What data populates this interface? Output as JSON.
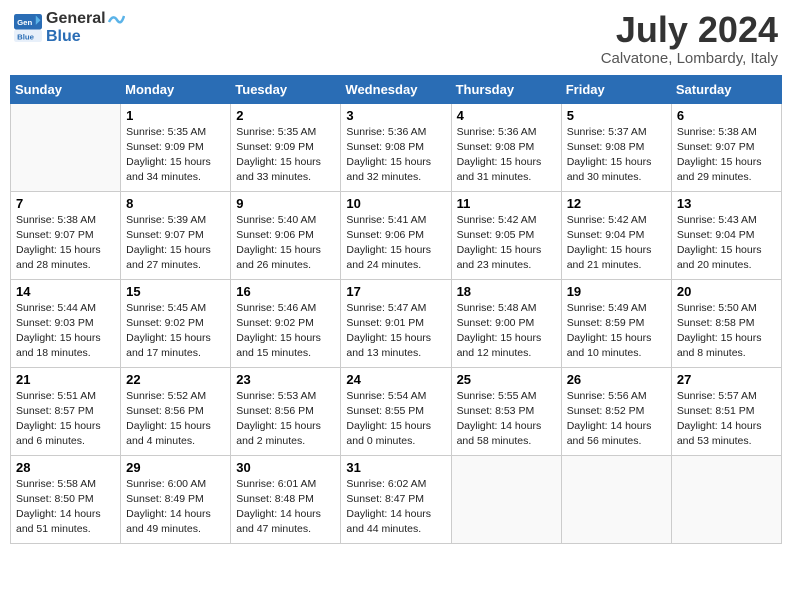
{
  "header": {
    "logo_line1": "General",
    "logo_line2": "Blue",
    "month": "July 2024",
    "location": "Calvatone, Lombardy, Italy"
  },
  "columns": [
    "Sunday",
    "Monday",
    "Tuesday",
    "Wednesday",
    "Thursday",
    "Friday",
    "Saturday"
  ],
  "weeks": [
    [
      {
        "day": "",
        "info": ""
      },
      {
        "day": "1",
        "info": "Sunrise: 5:35 AM\nSunset: 9:09 PM\nDaylight: 15 hours\nand 34 minutes."
      },
      {
        "day": "2",
        "info": "Sunrise: 5:35 AM\nSunset: 9:09 PM\nDaylight: 15 hours\nand 33 minutes."
      },
      {
        "day": "3",
        "info": "Sunrise: 5:36 AM\nSunset: 9:08 PM\nDaylight: 15 hours\nand 32 minutes."
      },
      {
        "day": "4",
        "info": "Sunrise: 5:36 AM\nSunset: 9:08 PM\nDaylight: 15 hours\nand 31 minutes."
      },
      {
        "day": "5",
        "info": "Sunrise: 5:37 AM\nSunset: 9:08 PM\nDaylight: 15 hours\nand 30 minutes."
      },
      {
        "day": "6",
        "info": "Sunrise: 5:38 AM\nSunset: 9:07 PM\nDaylight: 15 hours\nand 29 minutes."
      }
    ],
    [
      {
        "day": "7",
        "info": "Sunrise: 5:38 AM\nSunset: 9:07 PM\nDaylight: 15 hours\nand 28 minutes."
      },
      {
        "day": "8",
        "info": "Sunrise: 5:39 AM\nSunset: 9:07 PM\nDaylight: 15 hours\nand 27 minutes."
      },
      {
        "day": "9",
        "info": "Sunrise: 5:40 AM\nSunset: 9:06 PM\nDaylight: 15 hours\nand 26 minutes."
      },
      {
        "day": "10",
        "info": "Sunrise: 5:41 AM\nSunset: 9:06 PM\nDaylight: 15 hours\nand 24 minutes."
      },
      {
        "day": "11",
        "info": "Sunrise: 5:42 AM\nSunset: 9:05 PM\nDaylight: 15 hours\nand 23 minutes."
      },
      {
        "day": "12",
        "info": "Sunrise: 5:42 AM\nSunset: 9:04 PM\nDaylight: 15 hours\nand 21 minutes."
      },
      {
        "day": "13",
        "info": "Sunrise: 5:43 AM\nSunset: 9:04 PM\nDaylight: 15 hours\nand 20 minutes."
      }
    ],
    [
      {
        "day": "14",
        "info": "Sunrise: 5:44 AM\nSunset: 9:03 PM\nDaylight: 15 hours\nand 18 minutes."
      },
      {
        "day": "15",
        "info": "Sunrise: 5:45 AM\nSunset: 9:02 PM\nDaylight: 15 hours\nand 17 minutes."
      },
      {
        "day": "16",
        "info": "Sunrise: 5:46 AM\nSunset: 9:02 PM\nDaylight: 15 hours\nand 15 minutes."
      },
      {
        "day": "17",
        "info": "Sunrise: 5:47 AM\nSunset: 9:01 PM\nDaylight: 15 hours\nand 13 minutes."
      },
      {
        "day": "18",
        "info": "Sunrise: 5:48 AM\nSunset: 9:00 PM\nDaylight: 15 hours\nand 12 minutes."
      },
      {
        "day": "19",
        "info": "Sunrise: 5:49 AM\nSunset: 8:59 PM\nDaylight: 15 hours\nand 10 minutes."
      },
      {
        "day": "20",
        "info": "Sunrise: 5:50 AM\nSunset: 8:58 PM\nDaylight: 15 hours\nand 8 minutes."
      }
    ],
    [
      {
        "day": "21",
        "info": "Sunrise: 5:51 AM\nSunset: 8:57 PM\nDaylight: 15 hours\nand 6 minutes."
      },
      {
        "day": "22",
        "info": "Sunrise: 5:52 AM\nSunset: 8:56 PM\nDaylight: 15 hours\nand 4 minutes."
      },
      {
        "day": "23",
        "info": "Sunrise: 5:53 AM\nSunset: 8:56 PM\nDaylight: 15 hours\nand 2 minutes."
      },
      {
        "day": "24",
        "info": "Sunrise: 5:54 AM\nSunset: 8:55 PM\nDaylight: 15 hours\nand 0 minutes."
      },
      {
        "day": "25",
        "info": "Sunrise: 5:55 AM\nSunset: 8:53 PM\nDaylight: 14 hours\nand 58 minutes."
      },
      {
        "day": "26",
        "info": "Sunrise: 5:56 AM\nSunset: 8:52 PM\nDaylight: 14 hours\nand 56 minutes."
      },
      {
        "day": "27",
        "info": "Sunrise: 5:57 AM\nSunset: 8:51 PM\nDaylight: 14 hours\nand 53 minutes."
      }
    ],
    [
      {
        "day": "28",
        "info": "Sunrise: 5:58 AM\nSunset: 8:50 PM\nDaylight: 14 hours\nand 51 minutes."
      },
      {
        "day": "29",
        "info": "Sunrise: 6:00 AM\nSunset: 8:49 PM\nDaylight: 14 hours\nand 49 minutes."
      },
      {
        "day": "30",
        "info": "Sunrise: 6:01 AM\nSunset: 8:48 PM\nDaylight: 14 hours\nand 47 minutes."
      },
      {
        "day": "31",
        "info": "Sunrise: 6:02 AM\nSunset: 8:47 PM\nDaylight: 14 hours\nand 44 minutes."
      },
      {
        "day": "",
        "info": ""
      },
      {
        "day": "",
        "info": ""
      },
      {
        "day": "",
        "info": ""
      }
    ]
  ]
}
